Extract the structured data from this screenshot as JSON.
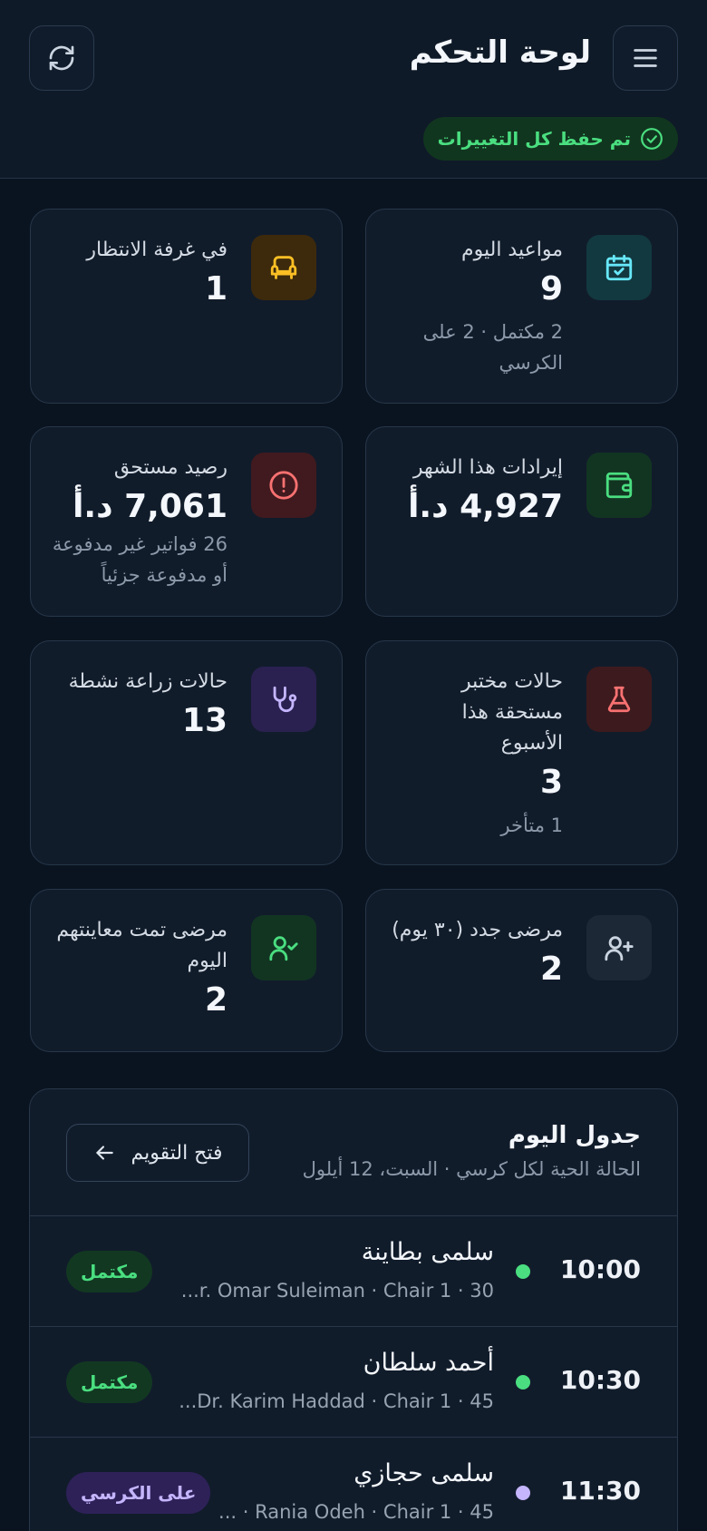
{
  "header": {
    "title": "لوحة التحكم",
    "saved_status": "تم حفظ كل التغييرات",
    "menu_icon": "menu-icon",
    "refresh_icon": "refresh-icon"
  },
  "stats": [
    {
      "label": "مواعيد اليوم",
      "value": "9",
      "sub": "2 مكتمل · 2 على الكرسي",
      "icon": "calendar-check-icon",
      "color": "#22d3ee"
    },
    {
      "label": "في غرفة الانتظار",
      "value": "1",
      "sub": "",
      "icon": "armchair-icon",
      "color": "#f59e0b"
    },
    {
      "label": "إيرادات هذا الشهر",
      "value": "4,927 د.أ",
      "sub": "",
      "icon": "wallet-icon",
      "color": "#22c55e"
    },
    {
      "label": "رصيد مستحق",
      "value": "7,061 د.أ",
      "sub": "26 فواتير غير مدفوعة أو مدفوعة جزئياً",
      "icon": "alert-circle-icon",
      "color": "#ef4444"
    },
    {
      "label": "حالات مختبر مستحقة هذا الأسبوع",
      "value": "3",
      "sub": "1 متأخر",
      "icon": "flask-icon",
      "color": "#f87171"
    },
    {
      "label": "حالات زراعة نشطة",
      "value": "13",
      "sub": "",
      "icon": "stethoscope-icon",
      "color": "#a78bfa"
    },
    {
      "label": "مرضى جدد (٣٠ يوم)",
      "value": "2",
      "sub": "",
      "icon": "user-plus-icon",
      "color": "#94a3b8"
    },
    {
      "label": "مرضى تمت معاينتهم اليوم",
      "value": "2",
      "sub": "",
      "icon": "user-check-icon",
      "color": "#4ade80"
    }
  ],
  "schedule": {
    "title": "جدول اليوم",
    "subtitle": "الحالة الحية لكل كرسي · السبت، 12 أيلول",
    "calendar_button": "فتح التقويم",
    "rows": [
      {
        "time": "10:00",
        "name": "سلمى بطاينة",
        "meta": "30 · Chair 1 · Dr. Omar Suleiman",
        "meta_display": "...r. Omar Suleiman · Chair 1 · 30",
        "status": "مكتمل",
        "status_type": "done"
      },
      {
        "time": "10:30",
        "name": "أحمد سلطان",
        "meta": "45 · Chair 1 · Dr. Karim Haddad",
        "meta_display": "...Dr. Karim Haddad · Chair 1 · 45",
        "status": "مكتمل",
        "status_type": "done"
      },
      {
        "time": "11:30",
        "name": "سلمى حجازي",
        "meta": "45 · Chair 1 · Rania Odeh",
        "meta_display": "... · Rania Odeh · Chair 1 · 45",
        "status": "على الكرسي",
        "status_type": "chair"
      }
    ]
  },
  "colors": {
    "done_bg": "#123822",
    "done_fg": "#4ade80",
    "chair_bg": "#2e2158",
    "chair_fg": "#c4b5fd"
  }
}
